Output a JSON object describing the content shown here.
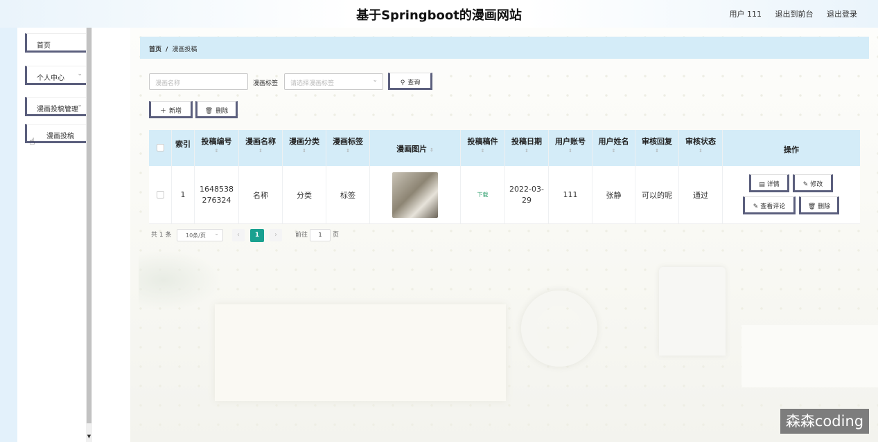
{
  "header": {
    "title": "基于Springboot的漫画网站",
    "user_label": "用户 111",
    "to_front_label": "退出到前台",
    "logout_label": "退出登录"
  },
  "sidebar": {
    "items": [
      {
        "label": "首页"
      },
      {
        "label": "个人中心",
        "has_chevron": true
      },
      {
        "label": "漫画投稿管理",
        "has_chevron": true
      },
      {
        "label": "漫画投稿"
      }
    ],
    "chevron": "⌄"
  },
  "breadcrumb": {
    "home": "首页",
    "separator": "/",
    "current": "漫画投稿"
  },
  "search": {
    "name_placeholder": "漫画名称",
    "tag_label": "漫画标签",
    "tag_placeholder": "请选择漫画标签",
    "search_label": "查询"
  },
  "actions": {
    "add_label": "新增",
    "delete_label": "删除"
  },
  "table": {
    "headers": [
      "索引",
      "投稿编号",
      "漫画名称",
      "漫画分类",
      "漫画标签",
      "漫画图片",
      "投稿稿件",
      "投稿日期",
      "用户账号",
      "用户姓名",
      "审核回复",
      "审核状态",
      "操作"
    ],
    "sort_icon": "⇕",
    "rows": [
      {
        "index": "1",
        "submission_no": "1648538276324",
        "name": "名称",
        "category": "分类",
        "tag": "标签",
        "file_link": "下载",
        "date": "2022-03-29",
        "account": "111",
        "username": "张静",
        "reply": "可以的呢",
        "status": "通过"
      }
    ],
    "ops": {
      "detail": "详情",
      "edit": "修改",
      "comments": "查看评论",
      "delete": "删除"
    }
  },
  "pagination": {
    "total": "共 1 条",
    "page_size": "10条/页",
    "current_page": "1",
    "goto_prefix": "前往",
    "goto_value": "1",
    "goto_suffix": "页"
  },
  "watermark": "森森coding",
  "colors": {
    "accent": "#1aa190",
    "header_bg": "#d4ecf8",
    "button_border": "#5b5f7d"
  }
}
